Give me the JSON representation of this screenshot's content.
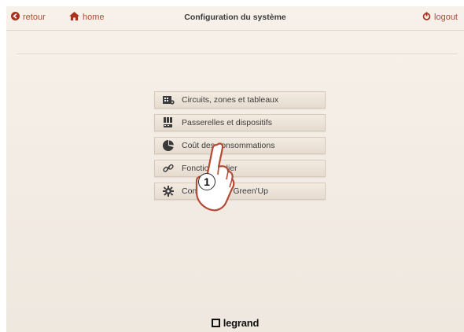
{
  "header": {
    "back_label": "retour",
    "home_label": "home",
    "title": "Configuration du système",
    "logout_label": "logout"
  },
  "menu": {
    "items": [
      {
        "label": "Circuits, zones et tableaux",
        "icon": "circuit-board-icon"
      },
      {
        "label": "Passerelles et dispositifs",
        "icon": "devices-icon"
      },
      {
        "label": "Coût des consommations",
        "icon": "pie-chart-icon"
      },
      {
        "label": "Fonction Relier",
        "icon": "link-icon"
      },
      {
        "label": "Configuration Green'Up",
        "icon": "gear-icon"
      }
    ]
  },
  "overlay": {
    "step_number": "1"
  },
  "footer": {
    "brand": "legrand"
  },
  "colors": {
    "accent": "#a8321e",
    "background": "#f2ebe3",
    "button": "#e9dfd3"
  }
}
